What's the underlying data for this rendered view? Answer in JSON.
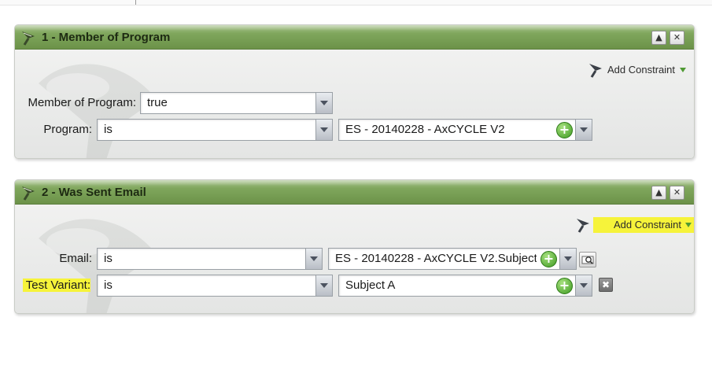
{
  "panels": [
    {
      "title": "1 - Member of Program",
      "add_constraint": "Add Constraint",
      "rows": [
        {
          "label": "Member of Program:",
          "operator": "true"
        },
        {
          "label": "Program:",
          "operator": "is",
          "value": "ES - 20140228 - AxCYCLE V2"
        }
      ]
    },
    {
      "title": "2 - Was Sent Email",
      "add_constraint": "Add Constraint",
      "rows": [
        {
          "label": "Email:",
          "operator": "is",
          "value": "ES - 20140228 - AxCYCLE V2.Subject"
        },
        {
          "label": "Test Variant:",
          "operator": "is",
          "value": "Subject A"
        }
      ]
    }
  ],
  "icons": {
    "collapse": "collapse-up-icon",
    "close": "close-x-icon",
    "flow": "flow-funnel-icon",
    "add": "plus-circle-icon",
    "search": "magnify-icon",
    "delete": "delete-x-icon"
  },
  "glyphs": {
    "collapse": "▲",
    "close": "✕",
    "plus": "+",
    "delete": "✖"
  },
  "colors": {
    "header_green": "#7fa65c",
    "highlight": "#f6f33a",
    "plus_green": "#3f9b22"
  }
}
